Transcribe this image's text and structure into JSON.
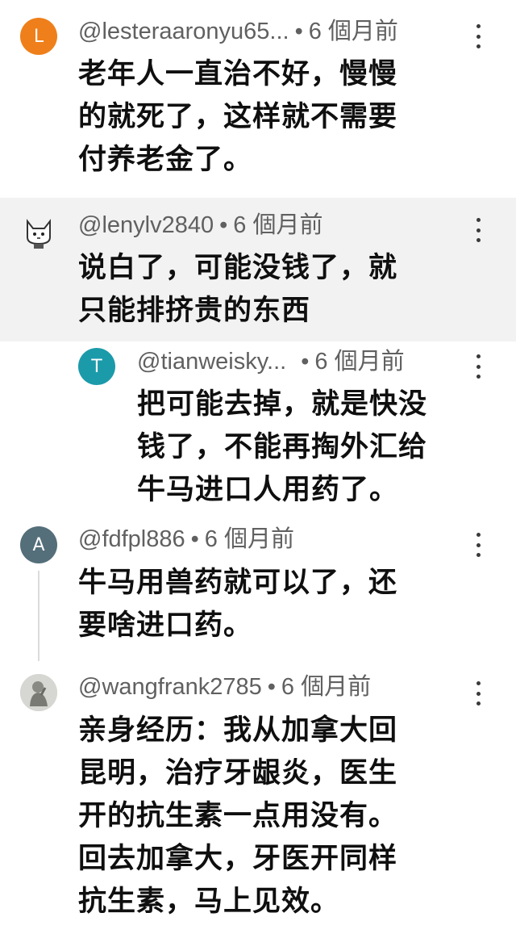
{
  "colors": {
    "avatar_l": "#ef7f1a",
    "avatar_t": "#1b9aaa",
    "avatar_a": "#546e7a",
    "highlight_bg": "#f2f2f2",
    "meta_text": "#606060",
    "body_text": "#0f0f0f"
  },
  "comments": [
    {
      "avatar_letter": "L",
      "handle": "@lesteraaronyu65...",
      "dot": "•",
      "time": "6 個月前",
      "lines": [
        "老年人一直治不好，慢慢",
        "的就死了，这样就不需要",
        "付养老金了。"
      ]
    },
    {
      "avatar_icon": "cat-icon",
      "handle": "@lenylv2840",
      "dot": "•",
      "time": "6 個月前",
      "lines": [
        "说白了，可能没钱了，就",
        "只能排挤贵的东西"
      ]
    },
    {
      "avatar_letter": "T",
      "handle": "@tianweisky...",
      "dot": "•",
      "time": "6 個月前",
      "lines": [
        "把可能去掉，就是快没",
        "钱了，不能再掏外汇给",
        "牛马进口人用药了。"
      ]
    },
    {
      "avatar_letter": "A",
      "handle": "@fdfpl886",
      "dot": "•",
      "time": "6 個月前",
      "lines": [
        "牛马用兽药就可以了，还",
        "要啥进口药。"
      ]
    },
    {
      "avatar_icon": "statue-photo-icon",
      "handle": "@wangfrank2785",
      "dot": "•",
      "time": "6 個月前",
      "lines": [
        "亲身经历：我从加拿大回",
        "昆明，治疗牙龈炎，医生",
        "开的抗生素一点用没有。",
        "回去加拿大，牙医开同样",
        "抗生素，马上见效。"
      ]
    }
  ]
}
